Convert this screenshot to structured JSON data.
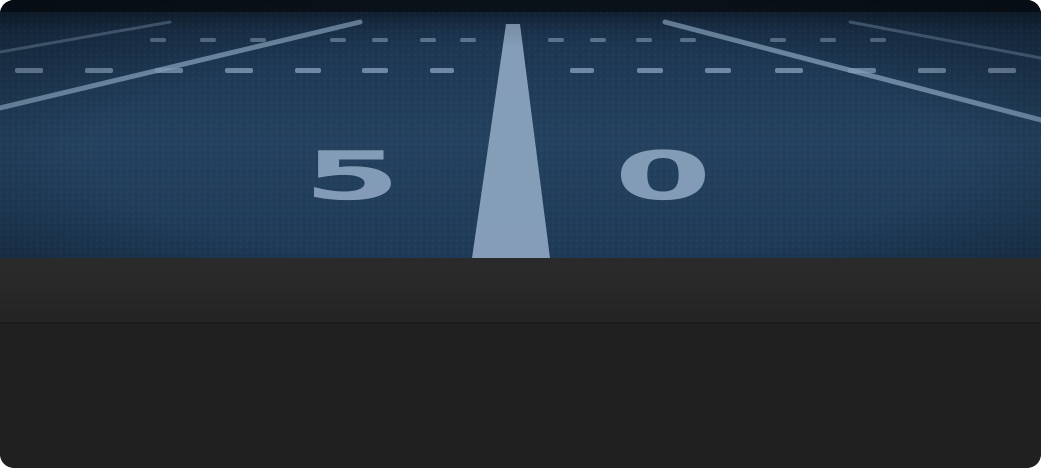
{
  "hero": {
    "yard_digit_left": "5",
    "yard_digit_right": "0"
  },
  "colors": {
    "turf_dark": "#14263a",
    "turf_mid": "#223e5c",
    "turf_light": "#2f5273",
    "line": "#8ea6c0",
    "panel": "#272727",
    "body": "#202020"
  }
}
